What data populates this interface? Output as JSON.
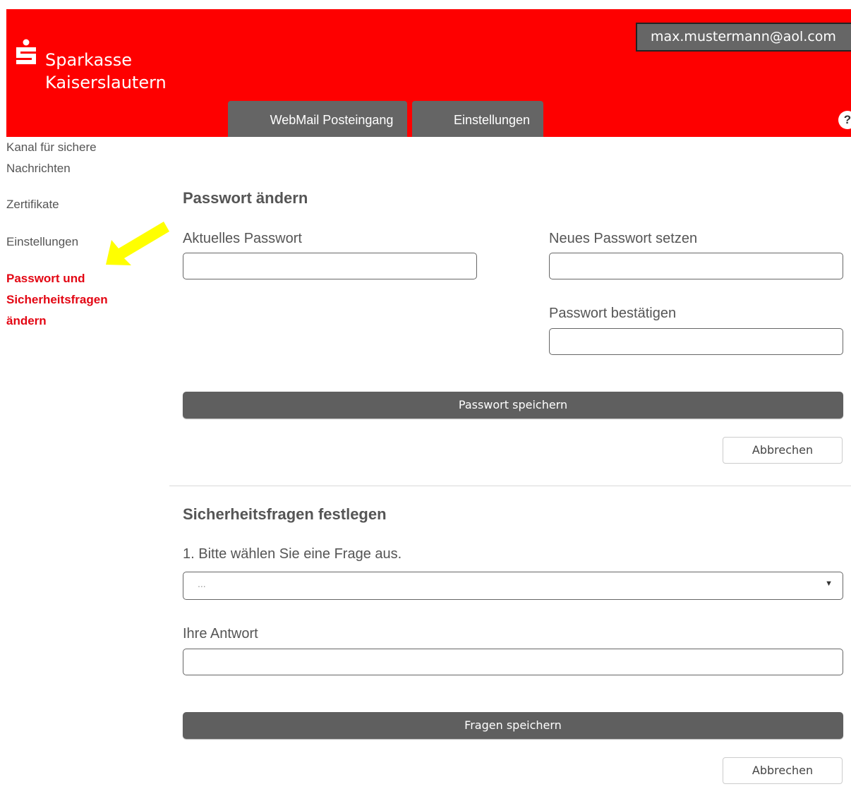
{
  "header": {
    "brand_line1": "Sparkasse",
    "brand_line2": "Kaiserslautern",
    "user_email": "max.mustermann@aol.com",
    "tabs": [
      {
        "label": "WebMail Posteingang"
      },
      {
        "label": "Einstellungen"
      }
    ],
    "help_symbol": "?",
    "colors": {
      "brand_red": "#fe0000",
      "tab_gray": "#656565"
    }
  },
  "sidebar": {
    "items": [
      {
        "label": "Kanal für sichere Nachrichten"
      },
      {
        "label": "Zertifikate"
      },
      {
        "label": "Einstellungen"
      },
      {
        "label": "Passwort und Sicherheitsfragen ändern",
        "active": true
      }
    ],
    "active_color": "#e30613",
    "annotation_arrow_color": "#ffff00"
  },
  "password_section": {
    "title": "Passwort ändern",
    "current_label": "Aktuelles Passwort",
    "new_label": "Neues Passwort setzen",
    "confirm_label": "Passwort bestätigen",
    "save_button": "Passwort speichern",
    "cancel_button": "Abbrechen"
  },
  "security_section": {
    "title": "Sicherheitsfragen festlegen",
    "question_label": "1. Bitte wählen Sie eine Frage aus.",
    "question_selected": "...",
    "answer_label": "Ihre Antwort",
    "save_button": "Fragen speichern",
    "cancel_button": "Abbrechen"
  }
}
